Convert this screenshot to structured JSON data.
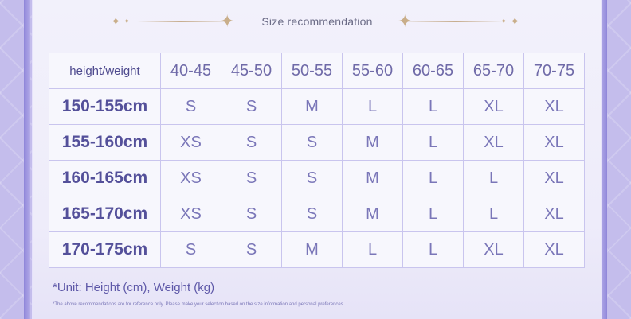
{
  "title": "Size recommendation",
  "header_label": "height/weight",
  "weights": [
    "40-45",
    "45-50",
    "50-55",
    "55-60",
    "60-65",
    "65-70",
    "70-75"
  ],
  "rows": [
    {
      "height": "150-155cm",
      "sizes": [
        "S",
        "S",
        "M",
        "L",
        "L",
        "XL",
        "XL"
      ]
    },
    {
      "height": "155-160cm",
      "sizes": [
        "XS",
        "S",
        "S",
        "M",
        "L",
        "XL",
        "XL"
      ]
    },
    {
      "height": "160-165cm",
      "sizes": [
        "XS",
        "S",
        "S",
        "M",
        "L",
        "L",
        "XL"
      ]
    },
    {
      "height": "165-170cm",
      "sizes": [
        "XS",
        "S",
        "S",
        "M",
        "L",
        "L",
        "XL"
      ]
    },
    {
      "height": "170-175cm",
      "sizes": [
        "S",
        "S",
        "M",
        "L",
        "L",
        "XL",
        "XL"
      ]
    }
  ],
  "unit_note": "*Unit: Height (cm), Weight (kg)",
  "disclaimer": "*The above recommendations are for reference only. Please make your selection based on the size information and personal preferences.",
  "icons": {
    "left_stars": "sparkle-icon",
    "right_stars": "sparkle-icon"
  },
  "colors": {
    "accent": "#5e58a8",
    "gold": "#c9ae8a",
    "background": "#c4bdec"
  }
}
